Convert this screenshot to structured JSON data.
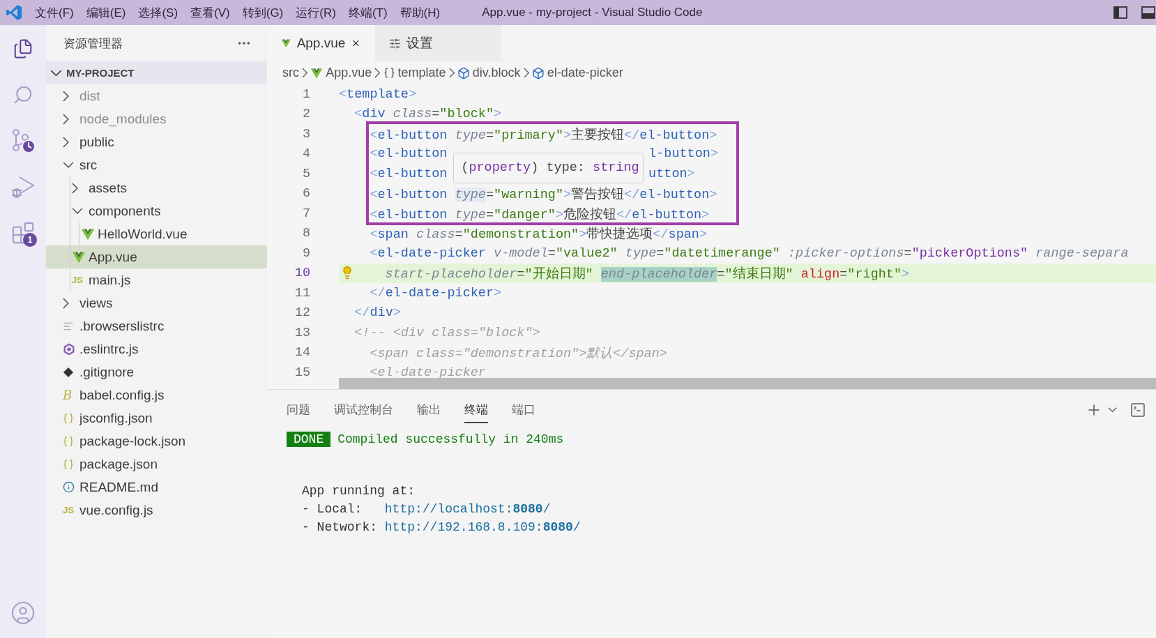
{
  "window": {
    "title": "App.vue - my-project - Visual Studio Code",
    "menus": [
      "文件(F)",
      "编辑(E)",
      "选择(S)",
      "查看(V)",
      "转到(G)",
      "运行(R)",
      "终端(T)",
      "帮助(H)"
    ]
  },
  "activity_bar": {
    "items": [
      {
        "kind": "files",
        "selected": true
      },
      {
        "kind": "search",
        "selected": false
      },
      {
        "kind": "source-control",
        "selected": false
      },
      {
        "kind": "run-debug",
        "selected": false
      },
      {
        "kind": "extensions",
        "selected": false,
        "badge": "1"
      }
    ]
  },
  "explorer": {
    "title": "资源管理器",
    "project": {
      "name": "MY-PROJECT",
      "expanded": true
    },
    "items": [
      {
        "name": "dist",
        "kind": "folder",
        "expanded": false,
        "ignored": true,
        "selected": false
      },
      {
        "name": "node_modules",
        "kind": "folder",
        "expanded": false,
        "ignored": true,
        "selected": false
      },
      {
        "name": "public",
        "kind": "folder",
        "expanded": false,
        "ignored": false,
        "selected": false
      },
      {
        "name": "src",
        "kind": "folder",
        "expanded": true,
        "ignored": false,
        "selected": false,
        "children": [
          {
            "name": "assets",
            "kind": "folder",
            "expanded": false,
            "ignored": false,
            "selected": false
          },
          {
            "name": "components",
            "kind": "folder",
            "expanded": true,
            "ignored": false,
            "selected": false,
            "children": [
              {
                "name": "HelloWorld.vue",
                "kind": "vue",
                "ignored": false,
                "selected": false
              }
            ]
          },
          {
            "name": "App.vue",
            "kind": "vue",
            "ignored": false,
            "selected": true
          },
          {
            "name": "main.js",
            "kind": "js",
            "icon_text": "JS",
            "ignored": false,
            "selected": false
          }
        ]
      },
      {
        "name": "views",
        "kind": "folder",
        "expanded": false,
        "ignored": false,
        "selected": false
      },
      {
        "name": ".browserslistrc",
        "kind": "lines",
        "ignored": false,
        "selected": false
      },
      {
        "name": ".eslintrc.js",
        "kind": "eslint",
        "ignored": false,
        "selected": false
      },
      {
        "name": ".gitignore",
        "kind": "git",
        "ignored": false,
        "selected": false
      },
      {
        "name": "babel.config.js",
        "kind": "babel",
        "icon_text": "B",
        "ignored": false,
        "selected": false
      },
      {
        "name": "jsconfig.json",
        "kind": "json",
        "ignored": false,
        "selected": false
      },
      {
        "name": "package-lock.json",
        "kind": "json",
        "ignored": false,
        "selected": false
      },
      {
        "name": "package.json",
        "kind": "json",
        "ignored": false,
        "selected": false
      },
      {
        "name": "README.md",
        "kind": "info",
        "ignored": false,
        "selected": false
      },
      {
        "name": "vue.config.js",
        "kind": "js",
        "icon_text": "JS",
        "ignored": false,
        "selected": false
      }
    ]
  },
  "editor": {
    "tabs": [
      {
        "label": "App.vue",
        "kind": "vue",
        "selected": true
      },
      {
        "label": "设置",
        "kind": "settings",
        "selected": false
      }
    ],
    "breadcrumbs": [
      {
        "label": "src",
        "kind": "folder"
      },
      {
        "label": "App.vue",
        "kind": "vue"
      },
      {
        "label": "template",
        "kind": "braces"
      },
      {
        "label": "div.block",
        "kind": "cube"
      },
      {
        "label": "el-date-picker",
        "kind": "cube"
      }
    ],
    "lines": [
      {
        "number": "1",
        "current": false,
        "tokens": [
          {
            "kind": "bracket",
            "text": "<"
          },
          {
            "kind": "tag",
            "text": "template"
          },
          {
            "kind": "bracket",
            "text": ">"
          }
        ]
      },
      {
        "number": "2",
        "current": false,
        "tokens": [
          {
            "kind": "bracket",
            "text": "  <"
          },
          {
            "kind": "tag",
            "text": "div"
          },
          {
            "kind": "attr",
            "text": " class"
          },
          {
            "kind": "punct",
            "text": "="
          },
          {
            "kind": "string",
            "text": "\"block\""
          },
          {
            "kind": "bracket",
            "text": ">"
          }
        ]
      },
      {
        "number": "3",
        "current": false,
        "tokens": [
          {
            "kind": "bracket",
            "text": "    <"
          },
          {
            "kind": "tag",
            "text": "el-button"
          },
          {
            "kind": "attr",
            "text": " type"
          },
          {
            "kind": "punct",
            "text": "="
          },
          {
            "kind": "string",
            "text": "\"primary\""
          },
          {
            "kind": "bracket",
            "text": ">"
          },
          {
            "kind": "text",
            "text": "主要按钮"
          },
          {
            "kind": "bracket",
            "text": "</"
          },
          {
            "kind": "tag",
            "text": "el-button"
          },
          {
            "kind": "bracket",
            "text": ">"
          }
        ]
      },
      {
        "number": "4",
        "current": false,
        "tokens": [
          {
            "kind": "bracket",
            "text": "    <"
          },
          {
            "kind": "tag",
            "text": "el-button"
          },
          {
            "kind": "gap"
          },
          {
            "kind": "tag",
            "text": "l-button"
          },
          {
            "kind": "bracket",
            "text": ">"
          }
        ]
      },
      {
        "number": "5",
        "current": false,
        "tokens": [
          {
            "kind": "bracket",
            "text": "    <"
          },
          {
            "kind": "tag",
            "text": "el-button"
          },
          {
            "kind": "gap"
          },
          {
            "kind": "tag",
            "text": "utton"
          },
          {
            "kind": "bracket",
            "text": ">"
          }
        ]
      },
      {
        "number": "6",
        "current": false,
        "tokens": [
          {
            "kind": "bracket",
            "text": "    <"
          },
          {
            "kind": "tag",
            "text": "el-button "
          },
          {
            "kind": "attr",
            "text": "type",
            "highlighted": true
          },
          {
            "kind": "punct",
            "text": "="
          },
          {
            "kind": "string",
            "text": "\"warning\""
          },
          {
            "kind": "bracket",
            "text": ">"
          },
          {
            "kind": "text",
            "text": "警告按钮"
          },
          {
            "kind": "bracket",
            "text": "</"
          },
          {
            "kind": "tag",
            "text": "el-button"
          },
          {
            "kind": "bracket",
            "text": ">"
          }
        ]
      },
      {
        "number": "7",
        "current": false,
        "tokens": [
          {
            "kind": "bracket",
            "text": "    <"
          },
          {
            "kind": "tag",
            "text": "el-button"
          },
          {
            "kind": "attr",
            "text": " type"
          },
          {
            "kind": "punct",
            "text": "="
          },
          {
            "kind": "string",
            "text": "\"danger\""
          },
          {
            "kind": "bracket",
            "text": ">"
          },
          {
            "kind": "text",
            "text": "危险按钮"
          },
          {
            "kind": "bracket",
            "text": "</"
          },
          {
            "kind": "tag",
            "text": "el-button"
          },
          {
            "kind": "bracket",
            "text": ">"
          }
        ]
      },
      {
        "number": "8",
        "current": false,
        "tokens": [
          {
            "kind": "bracket",
            "text": "    <"
          },
          {
            "kind": "tag",
            "text": "span"
          },
          {
            "kind": "attr",
            "text": " class"
          },
          {
            "kind": "punct",
            "text": "="
          },
          {
            "kind": "string",
            "text": "\"demonstration\""
          },
          {
            "kind": "bracket",
            "text": ">"
          },
          {
            "kind": "text",
            "text": "带快捷选项"
          },
          {
            "kind": "bracket",
            "text": "</"
          },
          {
            "kind": "tag",
            "text": "span"
          },
          {
            "kind": "bracket",
            "text": ">"
          }
        ]
      },
      {
        "number": "9",
        "current": false,
        "tokens": [
          {
            "kind": "bracket",
            "text": "    <"
          },
          {
            "kind": "tag",
            "text": "el-date-picker"
          },
          {
            "kind": "attr",
            "text": " v-model"
          },
          {
            "kind": "punct",
            "text": "="
          },
          {
            "kind": "string",
            "text": "\"value2\""
          },
          {
            "kind": "attr",
            "text": " type"
          },
          {
            "kind": "punct",
            "text": "="
          },
          {
            "kind": "string",
            "text": "\"datetimerange\""
          },
          {
            "kind": "attr",
            "text": " :picker-options"
          },
          {
            "kind": "punct",
            "text": "="
          },
          {
            "kind": "value",
            "text": "\"pickerOptions\""
          },
          {
            "kind": "attr",
            "text": " range-separa"
          }
        ]
      },
      {
        "number": "10",
        "current": true,
        "tokens": [
          {
            "kind": "attr",
            "text": "      start-placeholder"
          },
          {
            "kind": "punct",
            "text": "="
          },
          {
            "kind": "string",
            "text": "\"开始日期\" "
          },
          {
            "kind": "attr",
            "text": "end-placeholder",
            "selected": true
          },
          {
            "kind": "punct",
            "text": "="
          },
          {
            "kind": "string",
            "text": "\"结束日期\""
          },
          {
            "kind": "keyword",
            "text": " align"
          },
          {
            "kind": "punct",
            "text": "="
          },
          {
            "kind": "string",
            "text": "\"right\""
          },
          {
            "kind": "bracket",
            "text": ">"
          }
        ]
      },
      {
        "number": "11",
        "current": false,
        "tokens": [
          {
            "kind": "bracket",
            "text": "    </"
          },
          {
            "kind": "tag",
            "text": "el-date-picker"
          },
          {
            "kind": "bracket",
            "text": ">"
          }
        ]
      },
      {
        "number": "12",
        "current": false,
        "tokens": [
          {
            "kind": "bracket",
            "text": "  </"
          },
          {
            "kind": "tag",
            "text": "div"
          },
          {
            "kind": "bracket",
            "text": ">"
          }
        ]
      },
      {
        "number": "13",
        "current": false,
        "tokens": [
          {
            "kind": "comment",
            "text": "  <!-- <div class=\"block\">"
          }
        ]
      },
      {
        "number": "14",
        "current": false,
        "tokens": [
          {
            "kind": "comment",
            "text": "    <span class=\"demonstration\">默认</span>"
          }
        ]
      },
      {
        "number": "15",
        "current": false,
        "tokens": [
          {
            "kind": "comment",
            "text": "    <el-date-picker"
          }
        ]
      }
    ],
    "tooltip": {
      "parts": [
        {
          "kind": "punct",
          "text": "("
        },
        {
          "kind": "type",
          "text": "property"
        },
        {
          "kind": "punct",
          "text": ") type: "
        },
        {
          "kind": "type",
          "text": "string"
        }
      ]
    }
  },
  "panel": {
    "tabs": [
      {
        "label": "问题",
        "selected": false
      },
      {
        "label": "调试控制台",
        "selected": false
      },
      {
        "label": "输出",
        "selected": false
      },
      {
        "label": "终端",
        "selected": true
      },
      {
        "label": "端口",
        "selected": false
      }
    ],
    "terminal": {
      "status": "DONE",
      "message": "Compiled successfully in 240ms",
      "heading": "App running at:",
      "addresses": [
        {
          "label": "- Local:",
          "link": "http://localhost:**8080**/"
        },
        {
          "label": "- Network:",
          "link": "http://192.168.8.109:**8080**/"
        }
      ]
    }
  }
}
